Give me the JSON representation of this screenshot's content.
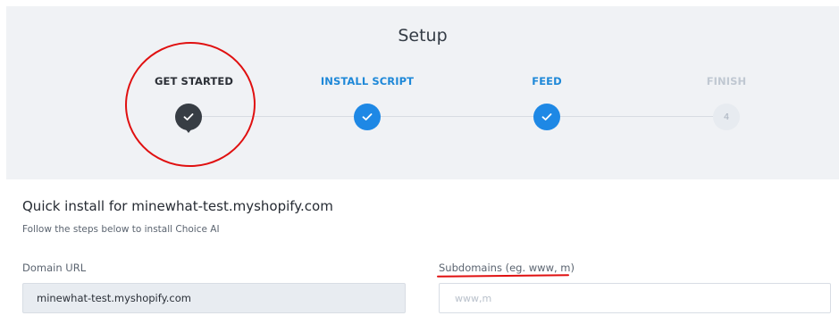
{
  "setup": {
    "title": "Setup"
  },
  "steps": [
    {
      "label": "GET STARTED",
      "state": "current",
      "icon": "check-icon"
    },
    {
      "label": "INSTALL SCRIPT",
      "state": "completed",
      "icon": "check-icon"
    },
    {
      "label": "FEED",
      "state": "completed",
      "icon": "check-icon"
    },
    {
      "label": "FINISH",
      "state": "pending",
      "number": "4"
    }
  ],
  "content": {
    "title": "Quick install for minewhat-test.myshopify.com",
    "subtitle": "Follow the steps below to install Choice AI",
    "domain_label": "Domain URL",
    "domain_value": "minewhat-test.myshopify.com",
    "subdomains_label": "Subdomains (eg. www, m)",
    "subdomains_placeholder": "www,m",
    "subdomains_value": ""
  },
  "colors": {
    "accent": "#1e88e5",
    "current_step": "#373d44",
    "pending_step": "#e7ebf0",
    "annotation": "#e01010",
    "header_bg": "#f0f2f5"
  }
}
